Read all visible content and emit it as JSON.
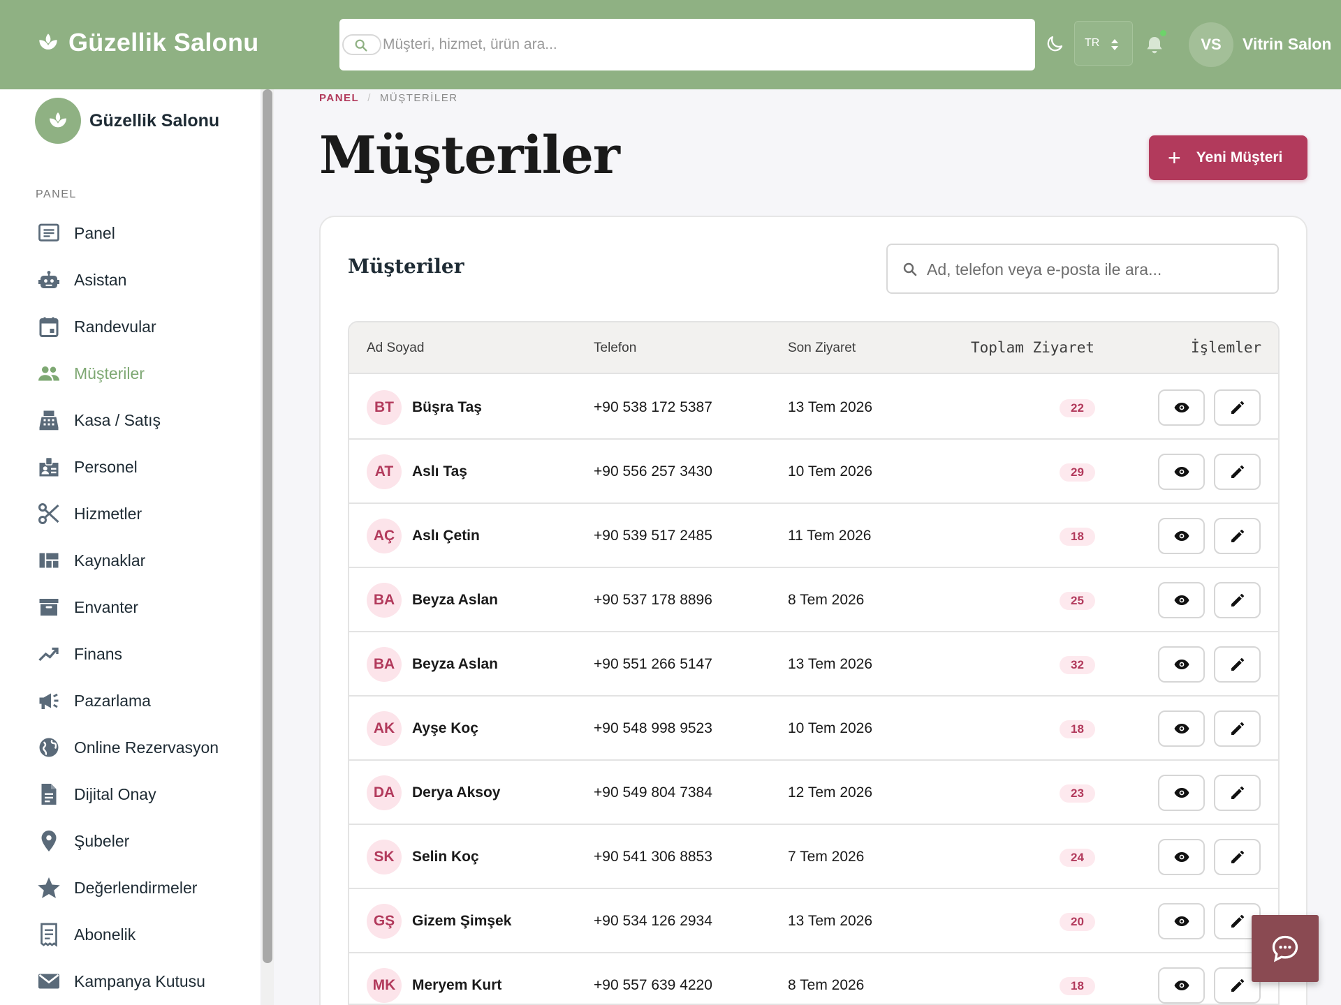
{
  "topbar": {
    "brand": "Güzellik Salonu",
    "search_placeholder": "Müşteri, hizmet, ürün ara...",
    "language": "TR",
    "user_initials": "VS",
    "user_name": "Vitrin Salon"
  },
  "sidebar": {
    "brand": "Güzellik Salonu",
    "section": "PANEL",
    "items": [
      {
        "label": "Panel",
        "icon": "dashboard-icon"
      },
      {
        "label": "Asistan",
        "icon": "robot-icon"
      },
      {
        "label": "Randevular",
        "icon": "calendar-icon"
      },
      {
        "label": "Müşteriler",
        "icon": "people-icon",
        "active": true
      },
      {
        "label": "Kasa / Satış",
        "icon": "cash-register-icon"
      },
      {
        "label": "Personel",
        "icon": "badge-icon"
      },
      {
        "label": "Hizmetler",
        "icon": "scissors-icon"
      },
      {
        "label": "Kaynaklar",
        "icon": "resources-icon"
      },
      {
        "label": "Envanter",
        "icon": "archive-icon"
      },
      {
        "label": "Finans",
        "icon": "trending-up-icon"
      },
      {
        "label": "Pazarlama",
        "icon": "megaphone-icon"
      },
      {
        "label": "Online Rezervasyon",
        "icon": "globe-icon"
      },
      {
        "label": "Dijital Onay",
        "icon": "document-icon"
      },
      {
        "label": "Şubeler",
        "icon": "location-pin-icon"
      },
      {
        "label": "Değerlendirmeler",
        "icon": "star-icon"
      },
      {
        "label": "Abonelik",
        "icon": "receipt-icon"
      },
      {
        "label": "Kampanya Kutusu",
        "icon": "mail-icon"
      }
    ]
  },
  "breadcrumb": {
    "root": "PANEL",
    "separator": "/",
    "current": "MÜŞTERİLER"
  },
  "page": {
    "title": "Müşteriler",
    "new_button": "Yeni Müşteri",
    "new_button_icon": "+"
  },
  "card": {
    "title": "Müşteriler",
    "search_placeholder": "Ad, telefon veya e-posta ile ara..."
  },
  "table": {
    "headers": {
      "name": "Ad Soyad",
      "phone": "Telefon",
      "last_visit": "Son Ziyaret",
      "total_visits": "Toplam Ziyaret",
      "actions": "İşlemler"
    },
    "rows": [
      {
        "initials": "BT",
        "name": "Büşra Taş",
        "phone": "+90 538 172 5387",
        "last_visit": "13 Tem 2026",
        "total_visits": "22"
      },
      {
        "initials": "AT",
        "name": "Aslı Taş",
        "phone": "+90 556 257 3430",
        "last_visit": "10 Tem 2026",
        "total_visits": "29"
      },
      {
        "initials": "AÇ",
        "name": "Aslı Çetin",
        "phone": "+90 539 517 2485",
        "last_visit": "11 Tem 2026",
        "total_visits": "18"
      },
      {
        "initials": "BA",
        "name": "Beyza Aslan",
        "phone": "+90 537 178 8896",
        "last_visit": "8 Tem 2026",
        "total_visits": "25"
      },
      {
        "initials": "BA",
        "name": "Beyza Aslan",
        "phone": "+90 551 266 5147",
        "last_visit": "13 Tem 2026",
        "total_visits": "32"
      },
      {
        "initials": "AK",
        "name": "Ayşe Koç",
        "phone": "+90 548 998 9523",
        "last_visit": "10 Tem 2026",
        "total_visits": "18"
      },
      {
        "initials": "DA",
        "name": "Derya Aksoy",
        "phone": "+90 549 804 7384",
        "last_visit": "12 Tem 2026",
        "total_visits": "23"
      },
      {
        "initials": "SK",
        "name": "Selin Koç",
        "phone": "+90 541 306 8853",
        "last_visit": "7 Tem 2026",
        "total_visits": "24"
      },
      {
        "initials": "GŞ",
        "name": "Gizem Şimşek",
        "phone": "+90 534 126 2934",
        "last_visit": "13 Tem 2026",
        "total_visits": "20"
      },
      {
        "initials": "MK",
        "name": "Meryem Kurt",
        "phone": "+90 557 639 4220",
        "last_visit": "8 Tem 2026",
        "total_visits": "18"
      }
    ]
  },
  "colors": {
    "header_green": "#8fb183",
    "accent": "#b23a5c",
    "active_nav": "#7ea873",
    "chat_button": "#8a4a52"
  }
}
